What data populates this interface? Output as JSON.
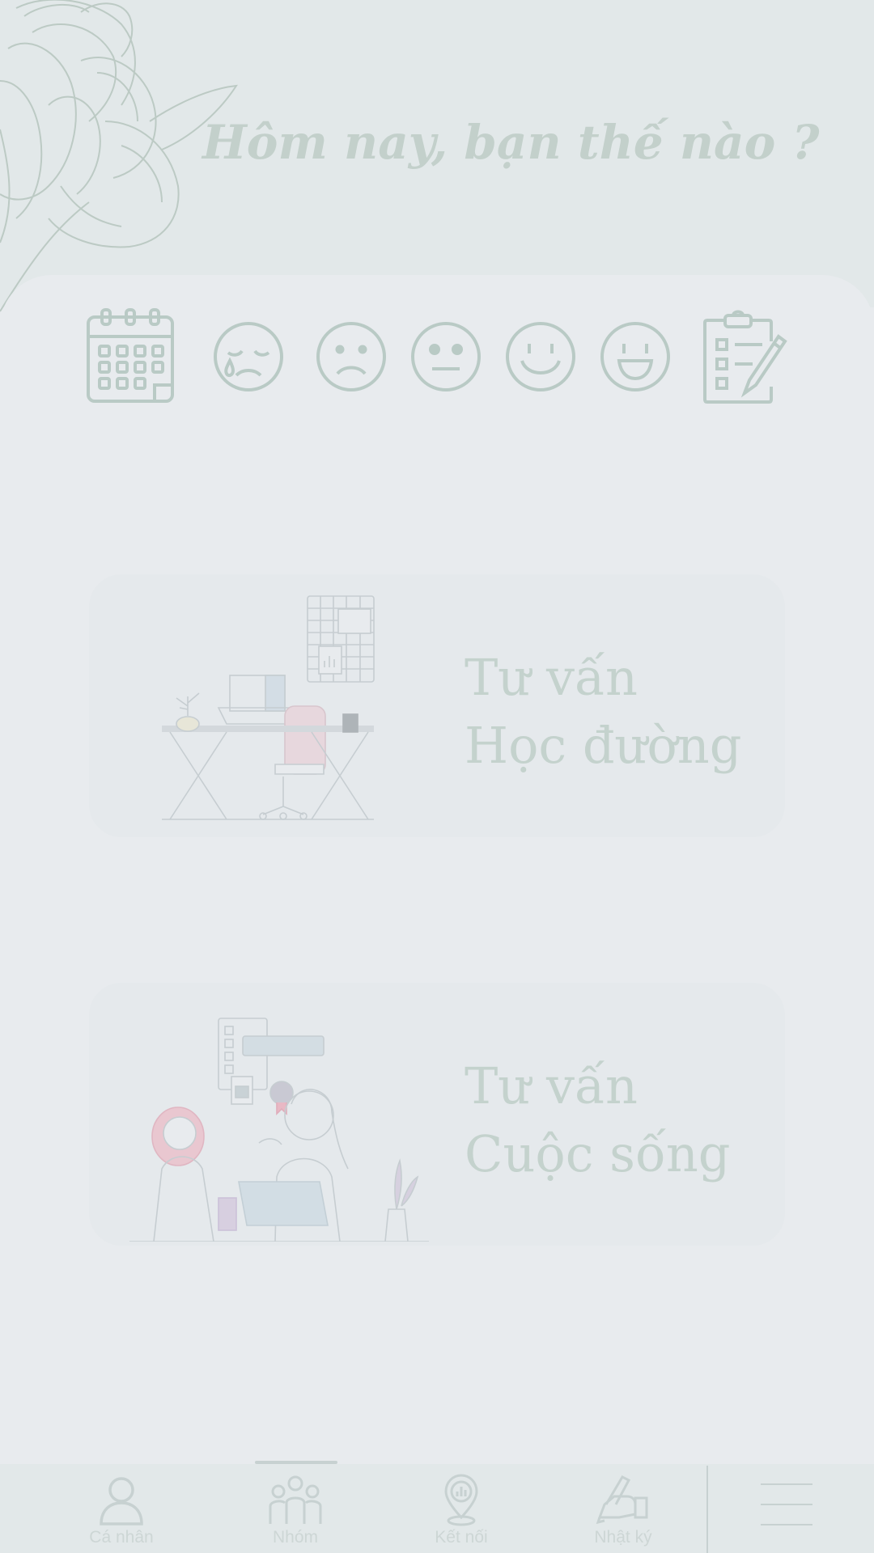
{
  "header": {
    "greeting": "Hôm nay, bạn thế nào ?"
  },
  "mood_bar": {
    "items": [
      "calendar-icon",
      "crying-face-icon",
      "sad-face-icon",
      "neutral-face-icon",
      "smile-face-icon",
      "happy-face-icon",
      "clipboard-checklist-icon"
    ]
  },
  "cards": [
    {
      "line1": "Tư vấn",
      "line2": "Học đường",
      "illustration": "desk-study-illustration"
    },
    {
      "line1": "Tư vấn",
      "line2": "Cuộc sống",
      "illustration": "counseling-conversation-illustration"
    }
  ],
  "nav": {
    "items": [
      {
        "label": "Cá nhân",
        "icon": "user-icon"
      },
      {
        "label": "Nhóm",
        "icon": "group-icon",
        "active": true
      },
      {
        "label": "Kết nối",
        "icon": "location-pin-icon"
      },
      {
        "label": "Nhật ký",
        "icon": "writing-hand-icon"
      }
    ],
    "menu_icon": "hamburger-menu-icon"
  },
  "colors": {
    "background": "#e8ebee",
    "header_background": "#e2e8e9",
    "accent": "#c3d0cb",
    "icon_stroke": "#b9cac5",
    "nav_text": "#cdd6d5"
  }
}
